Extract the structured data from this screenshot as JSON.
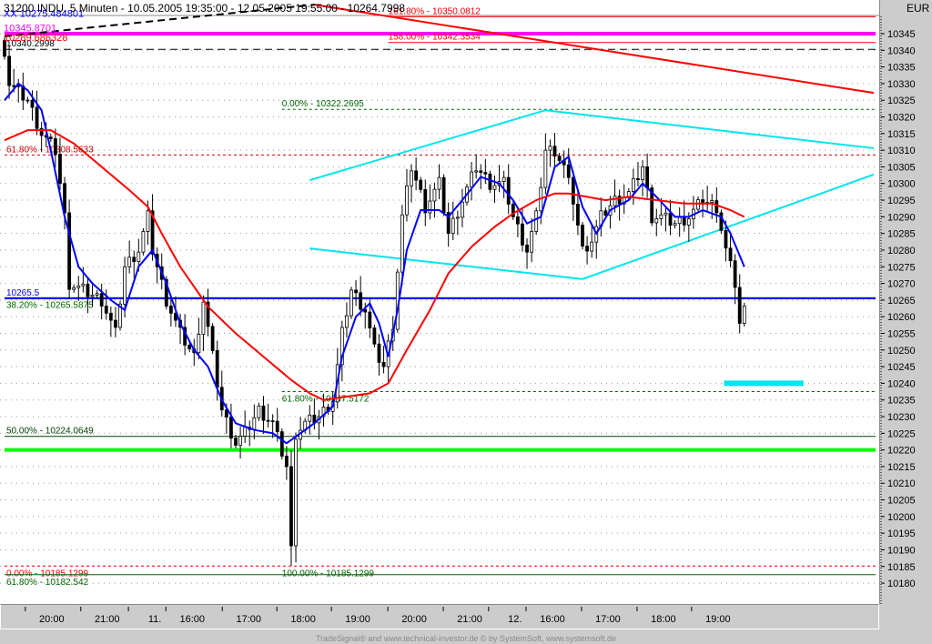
{
  "header": {
    "title": "31200  INDU, 5 Minuten - 10.05.2005 19:35:00 - 12.05.2005 19:55:00 - 10264.7998",
    "currency": "EUR"
  },
  "footer": "TradeSignal® and www.technical-investor.de © by  SystemSoft, www.systemsoft.de",
  "colors": {
    "candle": "#000000",
    "ma_short": "#0000ff",
    "ma_long": "#ff0000",
    "cyan": "#00e5ee",
    "magenta": "#ff00ff",
    "green": "#00ff00",
    "dark_green": "#006400",
    "red": "#ff0000",
    "blue": "#0000ff"
  },
  "chart_data": {
    "type": "candlestick",
    "title": "31200 INDU, 5 Minuten",
    "ylim": [
      10177,
      10349
    ],
    "y_ticks": [
      10345,
      10340,
      10335,
      10330,
      10325,
      10320,
      10315,
      10310,
      10305,
      10300,
      10295,
      10290,
      10285,
      10280,
      10275,
      10270,
      10265,
      10260,
      10255,
      10250,
      10245,
      10240,
      10235,
      10230,
      10225,
      10220,
      10215,
      10210,
      10205,
      10200,
      10195,
      10190,
      10185,
      10180
    ],
    "x_labels": [
      {
        "bar": 10.2,
        "label": "20:00"
      },
      {
        "bar": 22.2,
        "label": "21:00"
      },
      {
        "bar": 32.5,
        "label": "11."
      },
      {
        "bar": 40.6,
        "label": "16:00"
      },
      {
        "bar": 52.8,
        "label": "17:00"
      },
      {
        "bar": 64.6,
        "label": "18:00"
      },
      {
        "bar": 76.4,
        "label": "19:00"
      },
      {
        "bar": 88.6,
        "label": "20:00"
      },
      {
        "bar": 100.6,
        "label": "21:00"
      },
      {
        "bar": 110.4,
        "label": "12."
      },
      {
        "bar": 118.5,
        "label": "16:00"
      },
      {
        "bar": 130.5,
        "label": "17:00"
      },
      {
        "bar": 142.5,
        "label": "18:00"
      },
      {
        "bar": 154.3,
        "label": "19:00"
      }
    ],
    "bar_count": 161,
    "close_keypoints": [
      [
        0,
        10340
      ],
      [
        1,
        10330
      ],
      [
        5,
        10325
      ],
      [
        8,
        10315
      ],
      [
        11,
        10310
      ],
      [
        13,
        10290
      ],
      [
        14,
        10270
      ],
      [
        17,
        10268
      ],
      [
        21,
        10265
      ],
      [
        24,
        10255
      ],
      [
        26,
        10275
      ],
      [
        29,
        10280
      ],
      [
        31,
        10290
      ],
      [
        32,
        10280
      ],
      [
        35,
        10265
      ],
      [
        38,
        10255
      ],
      [
        41,
        10248
      ],
      [
        43,
        10265
      ],
      [
        45,
        10248
      ],
      [
        47,
        10232
      ],
      [
        50,
        10222
      ],
      [
        52,
        10225
      ],
      [
        55,
        10232
      ],
      [
        58,
        10228
      ],
      [
        61,
        10215
      ],
      [
        62,
        10190
      ],
      [
        63,
        10225
      ],
      [
        65,
        10228
      ],
      [
        68,
        10230
      ],
      [
        71,
        10235
      ],
      [
        73,
        10255
      ],
      [
        75,
        10268
      ],
      [
        78,
        10262
      ],
      [
        80,
        10250
      ],
      [
        82,
        10245
      ],
      [
        84,
        10258
      ],
      [
        86,
        10290
      ],
      [
        88,
        10305
      ],
      [
        91,
        10293
      ],
      [
        94,
        10300
      ],
      [
        96,
        10285
      ],
      [
        99,
        10295
      ],
      [
        102,
        10305
      ],
      [
        105,
        10300
      ],
      [
        108,
        10300
      ],
      [
        110,
        10290
      ],
      [
        113,
        10280
      ],
      [
        115,
        10290
      ],
      [
        117,
        10310
      ],
      [
        119,
        10310
      ],
      [
        121,
        10305
      ],
      [
        123,
        10295
      ],
      [
        125,
        10280
      ],
      [
        127,
        10283
      ],
      [
        129,
        10290
      ],
      [
        132,
        10295
      ],
      [
        135,
        10297
      ],
      [
        138,
        10305
      ],
      [
        140,
        10290
      ],
      [
        142,
        10290
      ],
      [
        145,
        10288
      ],
      [
        148,
        10290
      ],
      [
        151,
        10295
      ],
      [
        154,
        10293
      ],
      [
        156,
        10280
      ],
      [
        158,
        10270
      ],
      [
        159,
        10258
      ],
      [
        160,
        10262
      ]
    ],
    "low_extreme": {
      "bar": 62,
      "value": 10185.1299
    },
    "series": [
      {
        "name": "MA short",
        "color": "#0000ff",
        "keypoints": [
          [
            0,
            10325
          ],
          [
            3,
            10330
          ],
          [
            5,
            10328
          ],
          [
            8,
            10322
          ],
          [
            10,
            10310
          ],
          [
            13,
            10290
          ],
          [
            16,
            10275
          ],
          [
            19,
            10270
          ],
          [
            23,
            10265
          ],
          [
            26,
            10262
          ],
          [
            29,
            10275
          ],
          [
            32,
            10280
          ],
          [
            35,
            10270
          ],
          [
            38,
            10258
          ],
          [
            41,
            10250
          ],
          [
            44,
            10245
          ],
          [
            47,
            10235
          ],
          [
            50,
            10228
          ],
          [
            54,
            10226
          ],
          [
            58,
            10225
          ],
          [
            61,
            10222
          ],
          [
            64,
            10225
          ],
          [
            67,
            10228
          ],
          [
            71,
            10233
          ],
          [
            73,
            10248
          ],
          [
            76,
            10260
          ],
          [
            79,
            10264
          ],
          [
            81,
            10258
          ],
          [
            83,
            10248
          ],
          [
            85,
            10262
          ],
          [
            87,
            10280
          ],
          [
            90,
            10292
          ],
          [
            94,
            10292
          ],
          [
            96,
            10290
          ],
          [
            99,
            10295
          ],
          [
            103,
            10302
          ],
          [
            107,
            10300
          ],
          [
            110,
            10295
          ],
          [
            113,
            10288
          ],
          [
            116,
            10290
          ],
          [
            119,
            10305
          ],
          [
            122,
            10308
          ],
          [
            125,
            10293
          ],
          [
            128,
            10285
          ],
          [
            131,
            10292
          ],
          [
            135,
            10295
          ],
          [
            138,
            10300
          ],
          [
            141,
            10296
          ],
          [
            145,
            10290
          ],
          [
            148,
            10290
          ],
          [
            151,
            10292
          ],
          [
            155,
            10290
          ],
          [
            157,
            10285
          ],
          [
            160,
            10275
          ]
        ]
      },
      {
        "name": "MA long",
        "color": "#ff0000",
        "keypoints": [
          [
            0,
            10313
          ],
          [
            5,
            10316
          ],
          [
            10,
            10316
          ],
          [
            15,
            10312
          ],
          [
            21,
            10305
          ],
          [
            27,
            10298
          ],
          [
            31,
            10293
          ],
          [
            34,
            10285
          ],
          [
            38,
            10275
          ],
          [
            44,
            10263
          ],
          [
            50,
            10255
          ],
          [
            56,
            10248
          ],
          [
            62,
            10241
          ],
          [
            66,
            10237
          ],
          [
            69,
            10235
          ],
          [
            74,
            10236
          ],
          [
            79,
            10237
          ],
          [
            83,
            10240
          ],
          [
            87,
            10250
          ],
          [
            92,
            10262
          ],
          [
            96,
            10273
          ],
          [
            101,
            10281
          ],
          [
            106,
            10287
          ],
          [
            110,
            10291
          ],
          [
            115,
            10295
          ],
          [
            119,
            10297
          ],
          [
            122,
            10297
          ],
          [
            126,
            10296
          ],
          [
            130,
            10295
          ],
          [
            135,
            10296
          ],
          [
            141,
            10295
          ],
          [
            147,
            10294
          ],
          [
            153,
            10294
          ],
          [
            157,
            10292
          ],
          [
            160,
            10290
          ]
        ]
      }
    ],
    "hlines": [
      {
        "value": 10350.0812,
        "from": 83,
        "color": "#ff0000",
        "style": "solid",
        "width": 1,
        "label": "161.80% - 10350.0812",
        "label_color": "#ff0000"
      },
      {
        "value": 10345.0,
        "from": 0,
        "color": "#ff00ff",
        "style": "solid",
        "width": 4,
        "label": "",
        "label_color": ""
      },
      {
        "value": 10342.3534,
        "from": 83,
        "color": "#ff0000",
        "style": "solid",
        "width": 1,
        "label": "158.00% - 10342.3534",
        "label_color": "#ff0000"
      },
      {
        "value": 10340.2998,
        "from": 0,
        "color": "#000000",
        "style": "dash",
        "width": 1,
        "label": "10340.2998",
        "label_color": "#000000"
      },
      {
        "value": 10322.2695,
        "from": 60,
        "color": "#006400",
        "style": "dot",
        "width": 1,
        "label": "0.00% - 10322.2695",
        "label_color": "#006400"
      },
      {
        "value": 10308.5633,
        "from": 0,
        "color": "#cc0000",
        "style": "dot",
        "width": 1,
        "label": "61.80% - 10308.5633",
        "label_color": "#cc0000"
      },
      {
        "value": 10265.5875,
        "from": 0,
        "color": "#006400",
        "style": "solid",
        "width": 2,
        "label": "38.20% - 10265.5875",
        "label_color": "#006400"
      },
      {
        "value": 10265.5,
        "from": 0,
        "color": "#0000ff",
        "style": "solid",
        "width": 2,
        "label": "10265.5",
        "label_color": "#0000ff"
      },
      {
        "value": 10237.5172,
        "from": 60,
        "color": "#006400",
        "style": "dot",
        "width": 1,
        "label": "61.80% - 10237.5172",
        "label_color": "#006400"
      },
      {
        "value": 10224.0649,
        "from": 0,
        "color": "#004000",
        "style": "solid",
        "width": 1,
        "label": "50.00% - 10224.0649",
        "label_color": "#004000"
      },
      {
        "value": 10220.0,
        "from": 0,
        "color": "#00ff00",
        "style": "solid",
        "width": 4,
        "label": "",
        "label_color": ""
      },
      {
        "value": 10185.1299,
        "from": 0,
        "color": "#ff0000",
        "style": "dot",
        "width": 1,
        "label": "0.00% - 10185.1299",
        "label_color": "#ff0000"
      },
      {
        "value": 10185.1299,
        "from": 60,
        "color": "#006400",
        "style": "dot",
        "width": 0,
        "label": "100.00% - 10185.1299",
        "label_color": "#006400"
      },
      {
        "value": 10182.542,
        "from": 0,
        "color": "#006400",
        "style": "solid",
        "width": 1,
        "label": "61.80% - 10182.542",
        "label_color": "#006400"
      }
    ],
    "overlay_labels": [
      {
        "text": "XX 10275.484801",
        "color": "#0000ff",
        "value": 10349.5
      },
      {
        "text": "10345.8701",
        "color": "#ff00ff",
        "value": 10346.5
      },
      {
        "text": "10289.686328",
        "color": "#ff0000",
        "value": 10343.7
      }
    ],
    "trendlines": [
      {
        "name": "triangle-upper-left",
        "color": "#00e5ee",
        "p1": [
          66,
          10301
        ],
        "p2": [
          117,
          10322
        ]
      },
      {
        "name": "triangle-upper-right",
        "color": "#00e5ee",
        "p1": [
          117,
          10322
        ],
        "p2": [
          188,
          10310.6
        ]
      },
      {
        "name": "triangle-lower-left",
        "color": "#00e5ee",
        "p1": [
          66,
          10280.5
        ],
        "p2": [
          125,
          10271.3
        ]
      },
      {
        "name": "triangle-lower-right",
        "color": "#00e5ee",
        "p1": [
          125,
          10271.3
        ],
        "p2": [
          188,
          10302.7
        ]
      },
      {
        "name": "red-downtrend",
        "color": "#ff0000",
        "p1": [
          67,
          10353.7
        ],
        "p2": [
          188,
          10327.2
        ]
      },
      {
        "name": "black-dashed-trend",
        "color": "#000000",
        "p1": [
          0,
          10344.2
        ],
        "p2": [
          67,
          10353.7
        ]
      }
    ],
    "target_zone": {
      "from": 155.6,
      "to": 172.8,
      "value": 10240,
      "color": "#00e5ee"
    }
  }
}
